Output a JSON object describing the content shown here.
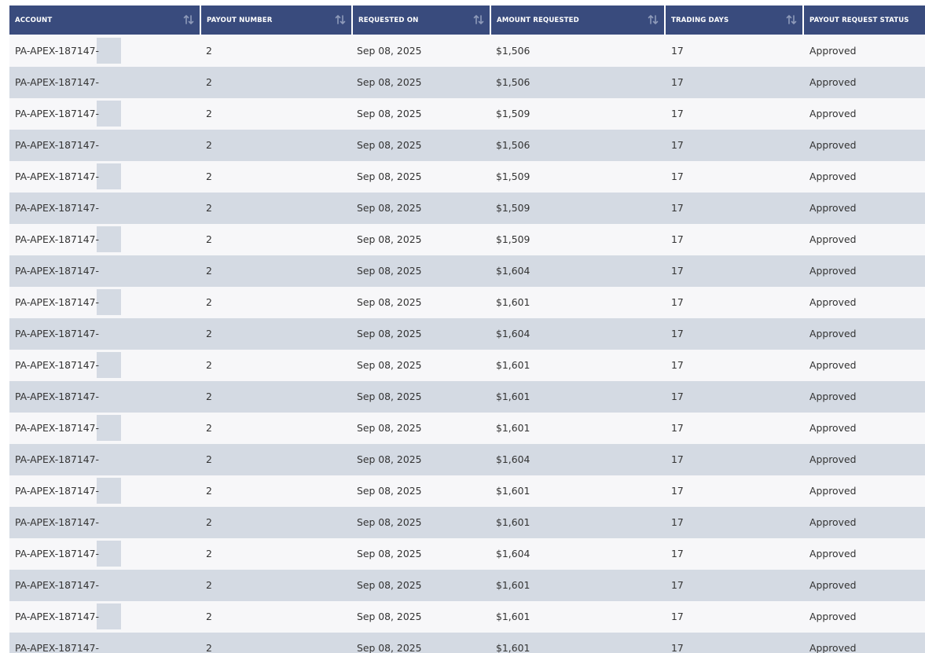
{
  "table": {
    "columns": [
      {
        "key": "account",
        "label": "ACCOUNT",
        "sortable": true
      },
      {
        "key": "payout_number",
        "label": "PAYOUT NUMBER",
        "sortable": true
      },
      {
        "key": "requested_on",
        "label": "REQUESTED ON",
        "sortable": true
      },
      {
        "key": "amount_requested",
        "label": "AMOUNT REQUESTED",
        "sortable": true
      },
      {
        "key": "trading_days",
        "label": "TRADING DAYS",
        "sortable": true
      },
      {
        "key": "status",
        "label": "PAYOUT REQUEST STATUS",
        "sortable": false
      }
    ],
    "rows": [
      {
        "account": "PA-APEX-187147-",
        "payout_number": "2",
        "requested_on": "Sep 08, 2025",
        "amount_requested": "$1,506",
        "trading_days": "17",
        "status": "Approved"
      },
      {
        "account": "PA-APEX-187147-",
        "payout_number": "2",
        "requested_on": "Sep 08, 2025",
        "amount_requested": "$1,506",
        "trading_days": "17",
        "status": "Approved"
      },
      {
        "account": "PA-APEX-187147-",
        "payout_number": "2",
        "requested_on": "Sep 08, 2025",
        "amount_requested": "$1,509",
        "trading_days": "17",
        "status": "Approved"
      },
      {
        "account": "PA-APEX-187147-",
        "payout_number": "2",
        "requested_on": "Sep 08, 2025",
        "amount_requested": "$1,506",
        "trading_days": "17",
        "status": "Approved"
      },
      {
        "account": "PA-APEX-187147-",
        "payout_number": "2",
        "requested_on": "Sep 08, 2025",
        "amount_requested": "$1,509",
        "trading_days": "17",
        "status": "Approved"
      },
      {
        "account": "PA-APEX-187147-",
        "payout_number": "2",
        "requested_on": "Sep 08, 2025",
        "amount_requested": "$1,509",
        "trading_days": "17",
        "status": "Approved"
      },
      {
        "account": "PA-APEX-187147-",
        "payout_number": "2",
        "requested_on": "Sep 08, 2025",
        "amount_requested": "$1,509",
        "trading_days": "17",
        "status": "Approved"
      },
      {
        "account": "PA-APEX-187147-",
        "payout_number": "2",
        "requested_on": "Sep 08, 2025",
        "amount_requested": "$1,604",
        "trading_days": "17",
        "status": "Approved"
      },
      {
        "account": "PA-APEX-187147-",
        "payout_number": "2",
        "requested_on": "Sep 08, 2025",
        "amount_requested": "$1,601",
        "trading_days": "17",
        "status": "Approved"
      },
      {
        "account": "PA-APEX-187147-",
        "payout_number": "2",
        "requested_on": "Sep 08, 2025",
        "amount_requested": "$1,604",
        "trading_days": "17",
        "status": "Approved"
      },
      {
        "account": "PA-APEX-187147-",
        "payout_number": "2",
        "requested_on": "Sep 08, 2025",
        "amount_requested": "$1,601",
        "trading_days": "17",
        "status": "Approved"
      },
      {
        "account": "PA-APEX-187147-",
        "payout_number": "2",
        "requested_on": "Sep 08, 2025",
        "amount_requested": "$1,601",
        "trading_days": "17",
        "status": "Approved"
      },
      {
        "account": "PA-APEX-187147-",
        "payout_number": "2",
        "requested_on": "Sep 08, 2025",
        "amount_requested": "$1,601",
        "trading_days": "17",
        "status": "Approved"
      },
      {
        "account": "PA-APEX-187147-",
        "payout_number": "2",
        "requested_on": "Sep 08, 2025",
        "amount_requested": "$1,604",
        "trading_days": "17",
        "status": "Approved"
      },
      {
        "account": "PA-APEX-187147-",
        "payout_number": "2",
        "requested_on": "Sep 08, 2025",
        "amount_requested": "$1,601",
        "trading_days": "17",
        "status": "Approved"
      },
      {
        "account": "PA-APEX-187147-",
        "payout_number": "2",
        "requested_on": "Sep 08, 2025",
        "amount_requested": "$1,601",
        "trading_days": "17",
        "status": "Approved"
      },
      {
        "account": "PA-APEX-187147-",
        "payout_number": "2",
        "requested_on": "Sep 08, 2025",
        "amount_requested": "$1,604",
        "trading_days": "17",
        "status": "Approved"
      },
      {
        "account": "PA-APEX-187147-",
        "payout_number": "2",
        "requested_on": "Sep 08, 2025",
        "amount_requested": "$1,601",
        "trading_days": "17",
        "status": "Approved"
      },
      {
        "account": "PA-APEX-187147-",
        "payout_number": "2",
        "requested_on": "Sep 08, 2025",
        "amount_requested": "$1,601",
        "trading_days": "17",
        "status": "Approved"
      },
      {
        "account": "PA-APEX-187147-",
        "payout_number": "2",
        "requested_on": "Sep 08, 2025",
        "amount_requested": "$1,601",
        "trading_days": "17",
        "status": "Approved"
      }
    ]
  },
  "icons": {
    "sort": "sort-arrows-icon"
  },
  "colors": {
    "header_bg": "#394b7d",
    "row_odd": "#f7f7f9",
    "row_even": "#d4dae3",
    "sort_icon": "#8e9ab9"
  }
}
